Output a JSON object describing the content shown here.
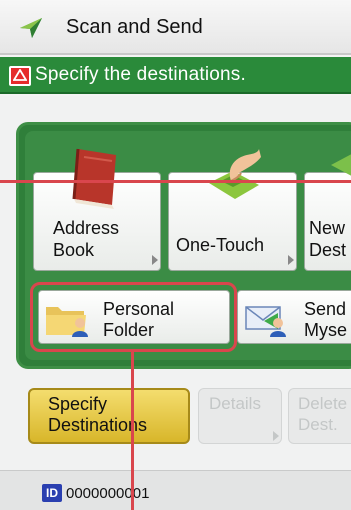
{
  "title_bar": {
    "title": "Scan and Send",
    "icon": "scan-send-icon"
  },
  "message_bar": {
    "text": "Specify the destinations.",
    "icon": "warning-icon"
  },
  "tiles": {
    "address_book": {
      "line1": "Address",
      "line2": "Book",
      "icon": "address-book-icon"
    },
    "one_touch": {
      "label": "One-Touch",
      "icon": "one-touch-icon"
    },
    "new_dest": {
      "line1": "New",
      "line2": "Dest"
    },
    "personal_folder": {
      "line1": "Personal",
      "line2": "Folder",
      "icon": "personal-folder-icon"
    },
    "send_myself": {
      "line1": "Send",
      "line2": "Myse",
      "icon": "send-myself-icon"
    }
  },
  "buttons": {
    "specify": {
      "line1": "Specify",
      "line2": "Destinations"
    },
    "details": {
      "label": "Details"
    },
    "delete": {
      "line1": "Delete",
      "line2": "Dest."
    }
  },
  "status_bar": {
    "id_badge": "ID",
    "id_value": "0000000001"
  },
  "colors": {
    "title_bar": "#e6e6e6",
    "message_bar": "#2a8a3a",
    "warning": "#e52b2b",
    "panel": "#3b8c45",
    "specify_button": "#d8b62a",
    "callout": "#d9464d",
    "id_badge": "#2a3fb0"
  }
}
